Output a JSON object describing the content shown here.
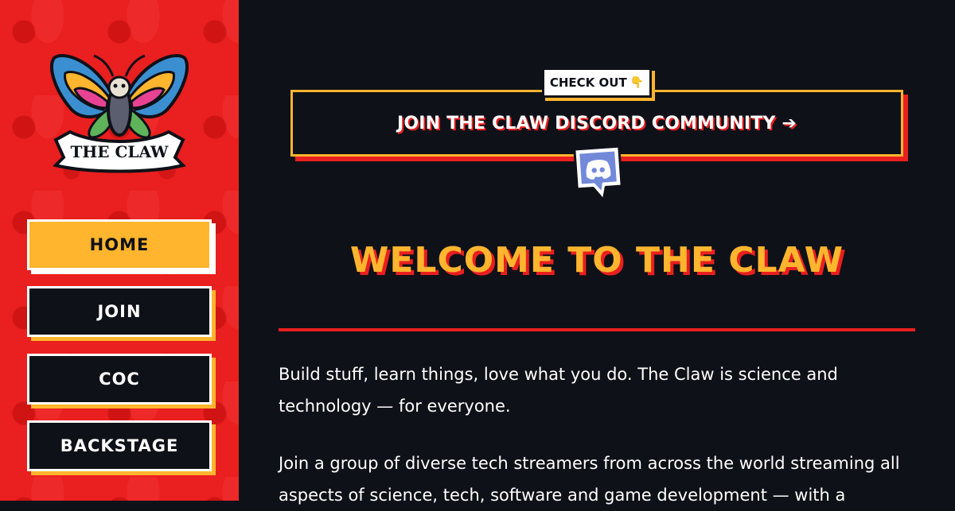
{
  "colors": {
    "background": "#0f1118",
    "sidebar_red": "#ea1f1f",
    "accent_yellow": "#ffb52e",
    "white": "#ffffff"
  },
  "logo": {
    "text": "THE CLAW",
    "icon": "moth-logo-icon"
  },
  "nav": {
    "items": [
      {
        "label": "HOME",
        "active": true
      },
      {
        "label": "JOIN",
        "active": false
      },
      {
        "label": "COC",
        "active": false
      },
      {
        "label": "BACKSTAGE",
        "active": false
      }
    ]
  },
  "banner": {
    "badge_label": "CHECK OUT",
    "badge_icon": "👇",
    "text": "JOIN THE CLAW DISCORD COMMUNITY ➔",
    "icon": "discord-icon"
  },
  "main": {
    "heading": "WELCOME TO THE CLAW",
    "paragraphs": [
      "Build stuff, learn things, love what you do. The Claw is science and technology — for everyone.",
      "Join a group of diverse tech streamers from across the world streaming all aspects of science, tech, software and game development — with a"
    ]
  }
}
